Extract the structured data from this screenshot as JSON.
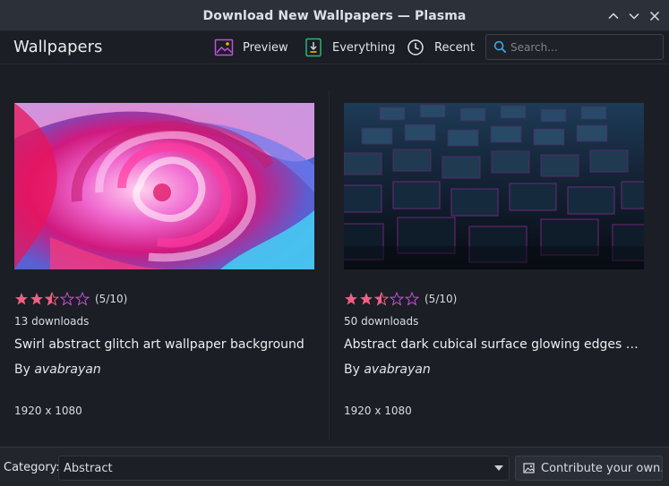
{
  "window": {
    "title": "Download New Wallpapers — Plasma"
  },
  "toolbar": {
    "heading": "Wallpapers",
    "preview_label": "Preview",
    "everything_label": "Everything",
    "recent_label": "Recent",
    "search_placeholder": "Search..."
  },
  "items": [
    {
      "rating": 5,
      "rating_max": 10,
      "rating_text": "(5/10)",
      "downloads": "13 downloads",
      "name": "Swirl abstract glitch art wallpaper background",
      "author_prefix": "By",
      "author": "avabrayan",
      "resolution": "1920 x 1080"
    },
    {
      "rating": 5,
      "rating_max": 10,
      "rating_text": "(5/10)",
      "downloads": "50 downloads",
      "name": "Abstract dark cubical surface glowing edges wal...",
      "author_prefix": "By",
      "author": "avabrayan",
      "resolution": "1920 x 1080"
    }
  ],
  "footer": {
    "category_label": "Category:",
    "category_value": "Abstract",
    "contribute_label": "Contribute your own..."
  },
  "colors": {
    "star_fill": "#ef5f86",
    "accent": "#3daee9",
    "preview_icon": "#c04ede",
    "everything_icon": "#2bb673"
  }
}
